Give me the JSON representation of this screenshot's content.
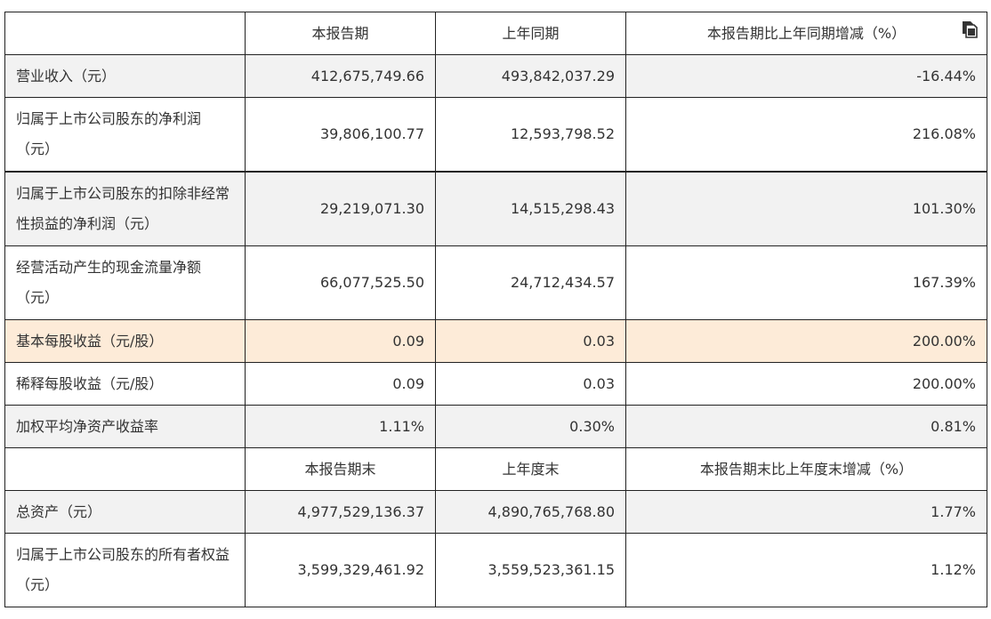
{
  "header": {
    "blank": "",
    "col1": "本报告期",
    "col2": "上年同期",
    "col3": "本报告期比上年同期增减（%）"
  },
  "rows": [
    {
      "label": "营业收入（元）",
      "v1": "412,675,749.66",
      "v2": "493,842,037.29",
      "v3": "-16.44%"
    },
    {
      "label": "归属于上市公司股东的净利润（元）",
      "v1": "39,806,100.77",
      "v2": "12,593,798.52",
      "v3": "216.08%"
    },
    {
      "label": "归属于上市公司股东的扣除非经常性损益的净利润（元）",
      "v1": "29,219,071.30",
      "v2": "14,515,298.43",
      "v3": "101.30%"
    },
    {
      "label": "经营活动产生的现金流量净额（元）",
      "v1": "66,077,525.50",
      "v2": "24,712,434.57",
      "v3": "167.39%"
    },
    {
      "label": "基本每股收益（元/股）",
      "v1": "0.09",
      "v2": "0.03",
      "v3": "200.00%"
    },
    {
      "label": "稀释每股收益（元/股）",
      "v1": "0.09",
      "v2": "0.03",
      "v3": "200.00%"
    },
    {
      "label": "加权平均净资产收益率",
      "v1": "1.11%",
      "v2": "0.30%",
      "v3": "0.81%"
    }
  ],
  "header2": {
    "blank": "",
    "col1": "本报告期末",
    "col2": "上年度末",
    "col3": "本报告期末比上年度末增减（%）"
  },
  "rows2": [
    {
      "label": "总资产（元）",
      "v1": "4,977,529,136.37",
      "v2": "4,890,765,768.80",
      "v3": "1.77%"
    },
    {
      "label": "归属于上市公司股东的所有者权益（元）",
      "v1": "3,599,329,461.92",
      "v2": "3,559,523,361.15",
      "v3": "1.12%"
    }
  ],
  "icons": {
    "copy": "copy-icon"
  },
  "colors": {
    "row_gray": "#f2f2f2",
    "row_highlight": "#fdebd8",
    "border": "#222222",
    "text": "#333333"
  }
}
